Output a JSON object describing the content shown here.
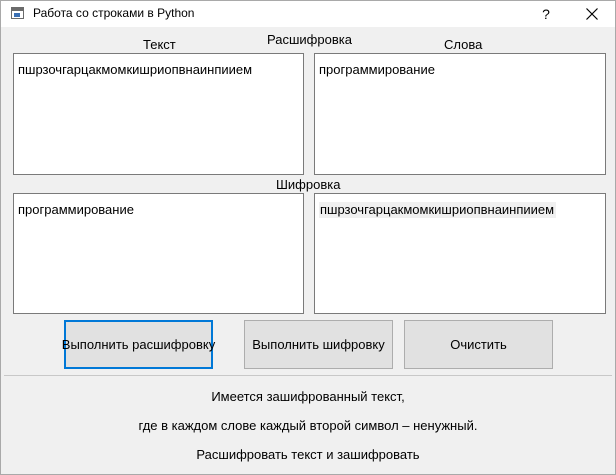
{
  "window": {
    "title": "Работа со строками в Python",
    "help_label": "?"
  },
  "decode_section": {
    "heading": "Расшифровка",
    "text_label": "Текст",
    "words_label": "Слова",
    "text_value": "пшрзочгарцакмомкишриопвнаинпиием",
    "words_value": "программирование"
  },
  "encode_section": {
    "heading": "Шифровка",
    "text_value": "программирование",
    "result_value": "пшрзочгарцакмомкишриопвнаинпиием"
  },
  "buttons": {
    "decode": "Выполнить расшифровку",
    "encode": "Выполнить шифровку",
    "clear": "Очистить"
  },
  "info": {
    "line1": "Имеется зашифрованный текст,",
    "line2": "где в каждом слове каждый второй символ – ненужный.",
    "line3": "Расшифровать текст и зашифровать"
  },
  "colors": {
    "accent": "#0078d7",
    "window_bg": "#f0f0f0",
    "button_bg": "#e1e1e1"
  }
}
